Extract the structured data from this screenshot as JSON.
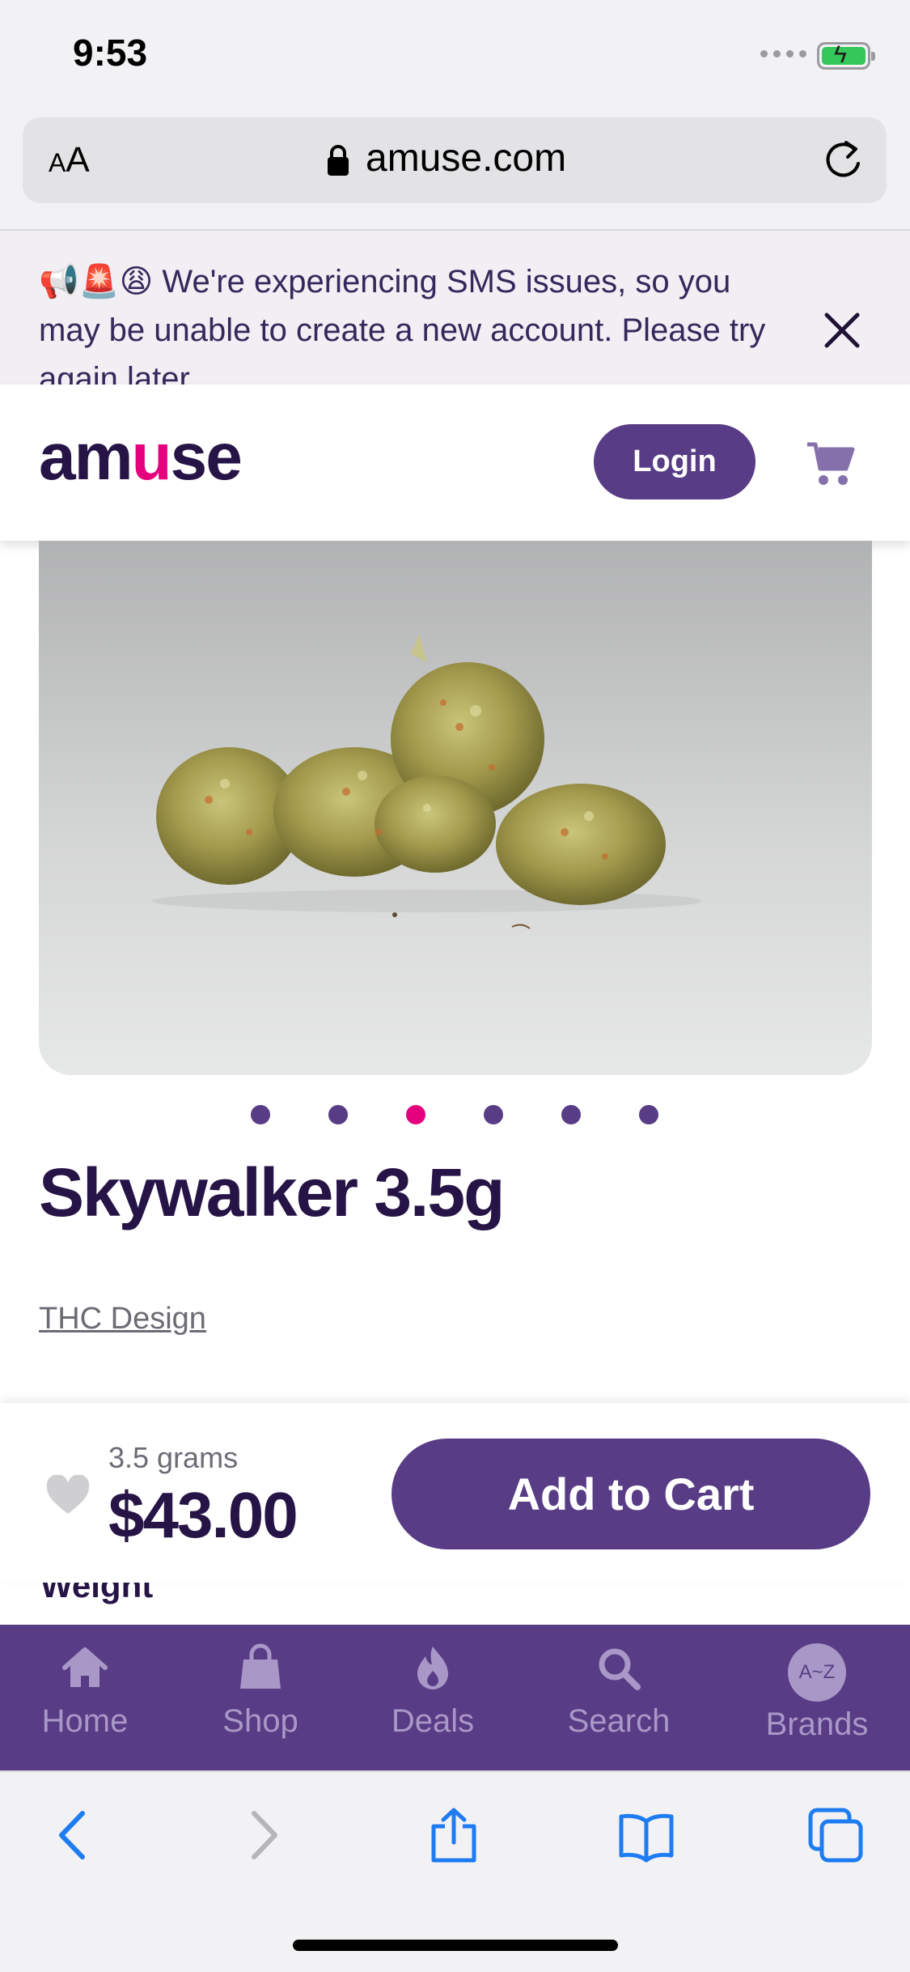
{
  "status_bar": {
    "time": "9:53"
  },
  "browser": {
    "text_size_label": "AA",
    "domain": "amuse.com"
  },
  "banner": {
    "message": "📢🚨😩 We're experiencing SMS issues, so you may be unable to create a new account. Please try again later."
  },
  "header": {
    "logo_text_a": "am",
    "logo_text_u": "u",
    "logo_text_b": "se",
    "login_label": "Login"
  },
  "product": {
    "carousel_count": 6,
    "carousel_active_index": 2,
    "title": "Skywalker 3.5g",
    "brand": "THC Design",
    "section_label": "Weight"
  },
  "buy_bar": {
    "size": "3.5 grams",
    "price": "$43.00",
    "add_to_cart_label": "Add to Cart"
  },
  "bottom_nav": {
    "items": [
      {
        "label": "Home",
        "icon": "home-icon"
      },
      {
        "label": "Shop",
        "icon": "shopping-bag-icon"
      },
      {
        "label": "Deals",
        "icon": "flame-icon"
      },
      {
        "label": "Search",
        "icon": "search-icon"
      },
      {
        "label": "Brands",
        "icon": "a-z-icon",
        "badge": "A~Z"
      }
    ]
  },
  "colors": {
    "brand_purple": "#583c85",
    "brand_pink": "#e5007e",
    "dark_text": "#261447"
  }
}
